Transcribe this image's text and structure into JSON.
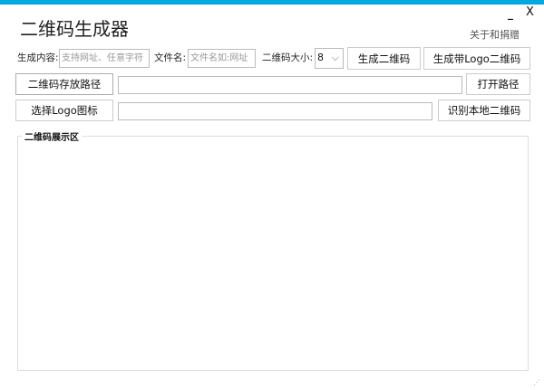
{
  "window": {
    "title": "二维码生成器",
    "about_link": "关于和捐赠",
    "minimize": "_",
    "close": "X",
    "accent": "#00a8e0"
  },
  "row1": {
    "content_label": "生成内容:",
    "content_placeholder": "支持网址、任意字符",
    "filename_label": "文件名:",
    "filename_placeholder": "文件名如:网址",
    "size_label": "二维码大小:",
    "size_value": "8",
    "generate_button": "生成二维码",
    "generate_logo_button": "生成带Logo二维码"
  },
  "row2": {
    "save_path_button": "二维码存放路径",
    "save_path_value": "",
    "open_path_button": "打开路径"
  },
  "row3": {
    "logo_button": "选择Logo图标",
    "logo_path_value": "",
    "recognize_button": "识别本地二维码"
  },
  "display": {
    "label": "二维码展示区"
  }
}
